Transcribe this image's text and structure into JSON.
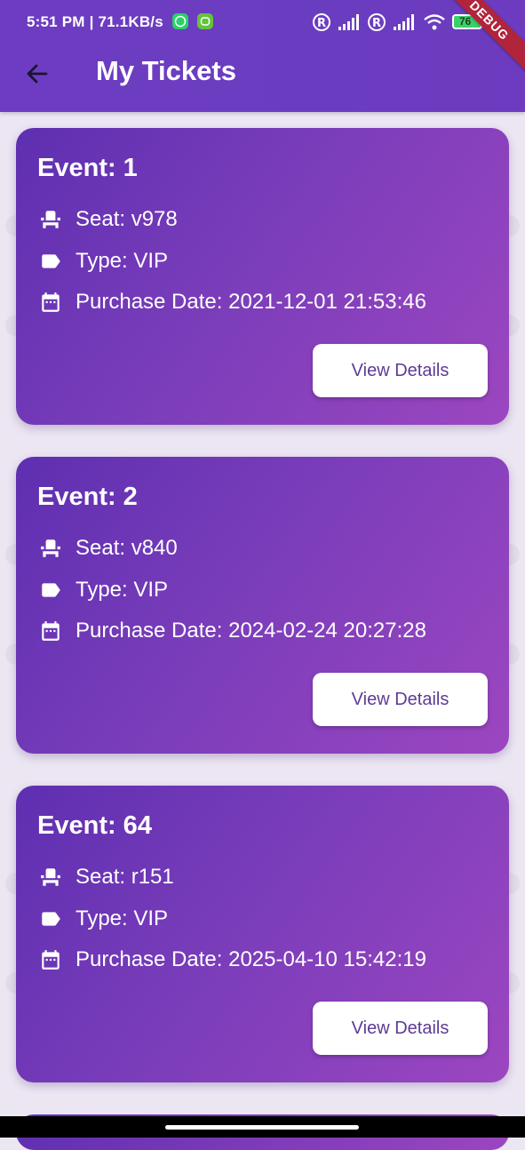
{
  "status_bar": {
    "time_speed": "5:51 PM | 71.1KB/s",
    "battery": "76",
    "debug_banner": "DEBUG"
  },
  "app_bar": {
    "title": "My Tickets"
  },
  "tickets": [
    {
      "event": "Event: 1",
      "seat": "Seat: v978",
      "type": "Type: VIP",
      "purchase_date": "Purchase Date: 2021-12-01 21:53:46",
      "button": "View Details"
    },
    {
      "event": "Event: 2",
      "seat": "Seat: v840",
      "type": "Type: VIP",
      "purchase_date": "Purchase Date: 2024-02-24 20:27:28",
      "button": "View Details"
    },
    {
      "event": "Event: 64",
      "seat": "Seat: r151",
      "type": "Type: VIP",
      "purchase_date": "Purchase Date: 2025-04-10 15:42:19",
      "button": "View Details"
    }
  ],
  "colors": {
    "accent": "#6a3dc0",
    "card_start": "#5e2fb1",
    "card_end": "#9c46c0",
    "background": "#ece6f3"
  },
  "icons": [
    "back-arrow-icon",
    "seat-icon",
    "tag-icon",
    "calendar-icon",
    "whatsapp-icon",
    "android-icon",
    "registered-icon",
    "signal-icon",
    "wifi-icon",
    "battery-icon"
  ]
}
